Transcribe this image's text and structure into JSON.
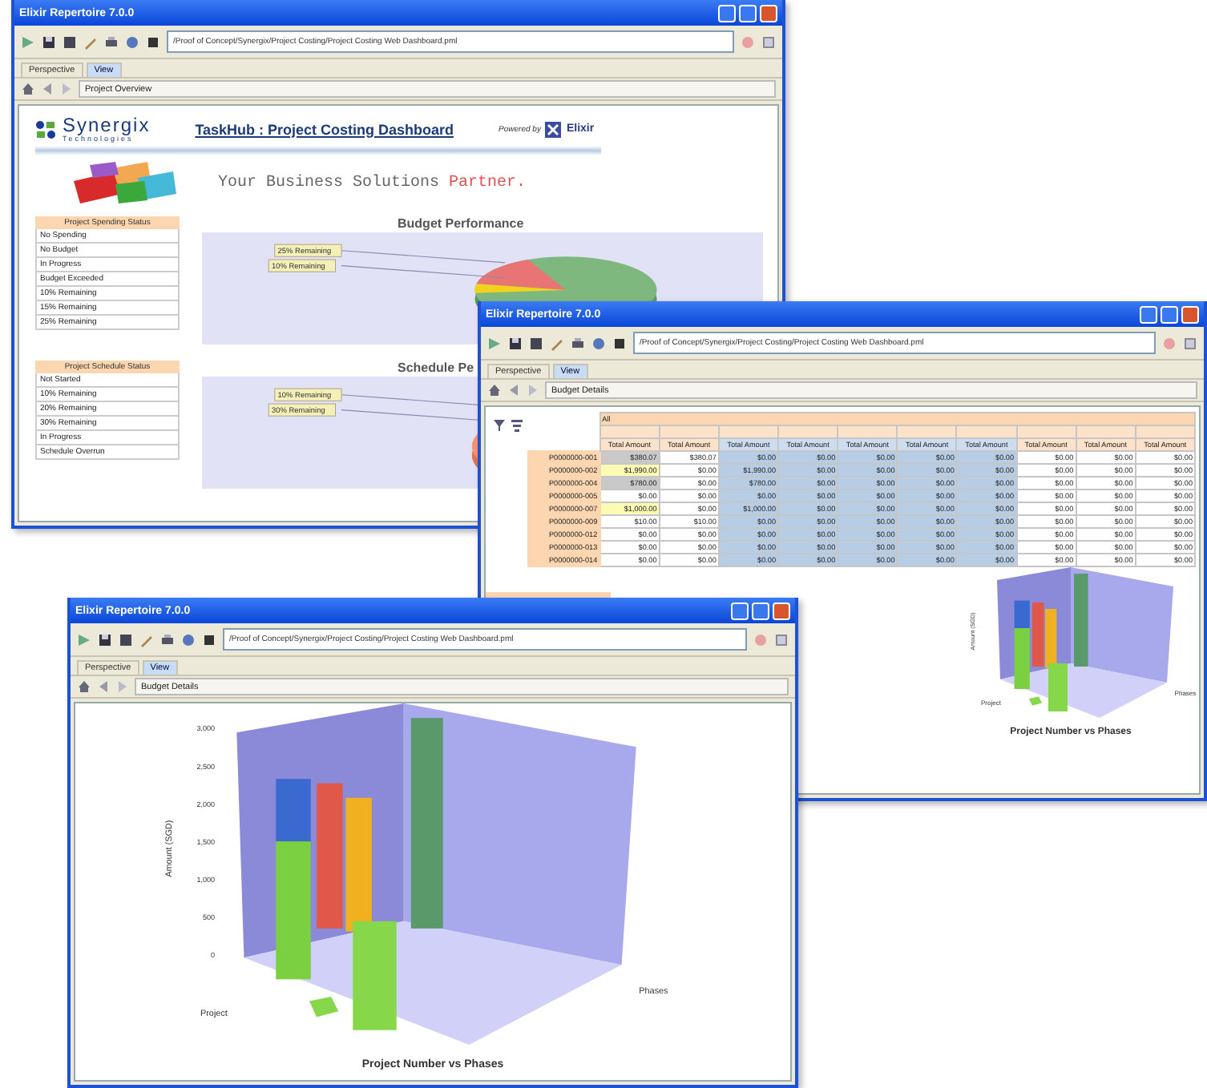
{
  "windows": [
    {
      "kind": "dashboard",
      "title": "Elixir Repertoire 7.0.0",
      "path": "/Proof of Concept/Synergix/Project Costing/Project Costing Web Dashboard.pml",
      "tabs": [
        {
          "label": "Perspective",
          "selected": false
        },
        {
          "label": "View",
          "selected": true
        }
      ],
      "location": "Project Overview",
      "header": {
        "brand": "Synergix",
        "brand_sub": "Technologies",
        "title": "TaskHub : Project Costing Dashboard",
        "powered_by": "Powered by",
        "partner": "Elixir",
        "slogan": "Your Business Solutions ",
        "slogan_accent": "Partner."
      },
      "panels": [
        {
          "kind": "budget",
          "status_title": "Project Spending Status",
          "status_items": [
            "No Spending",
            "No Budget",
            "In Progress",
            "Budget Exceeded",
            "10% Remaining",
            "15% Remaining",
            "25% Remaining"
          ],
          "chart_title": "Budget Performance",
          "callouts": [
            "25% Remaining",
            "10% Remaining"
          ]
        },
        {
          "kind": "schedule",
          "status_title": "Project Schedule Status",
          "status_items": [
            "Not Started",
            "10% Remaining",
            "20% Remaining",
            "30% Remaining",
            "In Progress",
            "Schedule Overrun"
          ],
          "chart_title": "Schedule Pe",
          "callouts": [
            "10% Remaining",
            "30% Remaining"
          ]
        }
      ]
    },
    {
      "kind": "table",
      "title": "Elixir Repertoire 7.0.0",
      "path": "/Proof of Concept/Synergix/Project Costing/Project Costing Web Dashboard.pml",
      "tabs": [
        {
          "label": "Perspective",
          "selected": false
        },
        {
          "label": "View",
          "selected": true
        }
      ],
      "location": "Budget Details",
      "table": {
        "group": "All",
        "columns": [
          {
            "heading": "Total Amount",
            "highlighted": false
          },
          {
            "heading": "Total Amount",
            "highlighted": false
          },
          {
            "heading": "Total Amount",
            "highlighted": true
          },
          {
            "heading": "Total Amount",
            "highlighted": true
          },
          {
            "heading": "Total Amount",
            "highlighted": true
          },
          {
            "heading": "Total Amount",
            "highlighted": true
          },
          {
            "heading": "Total Amount",
            "highlighted": true
          },
          {
            "heading": "Total Amount",
            "highlighted": false
          },
          {
            "heading": "Total Amount",
            "highlighted": false
          },
          {
            "heading": "Total Amount",
            "highlighted": false
          }
        ],
        "rows": [
          {
            "label": "P0000000-001",
            "color": "#c9c9c9",
            "cells": [
              "$380.07",
              "$380.07",
              "$0.00",
              "$0.00",
              "$0.00",
              "$0.00",
              "$0.00",
              "$0.00",
              "$0.00",
              "$0.00"
            ]
          },
          {
            "label": "P0000000-002",
            "color": "#fbfbb4",
            "cells": [
              "$1,990.00",
              "$0.00",
              "$1,990.00",
              "$0.00",
              "$0.00",
              "$0.00",
              "$0.00",
              "$0.00",
              "$0.00",
              "$0.00"
            ]
          },
          {
            "label": "P0000000-004",
            "color": "#c9c9c9",
            "cells": [
              "$780.00",
              "$0.00",
              "$780.00",
              "$0.00",
              "$0.00",
              "$0.00",
              "$0.00",
              "$0.00",
              "$0.00",
              "$0.00"
            ]
          },
          {
            "label": "P0000000-005",
            "cells": [
              "$0.00",
              "$0.00",
              "$0.00",
              "$0.00",
              "$0.00",
              "$0.00",
              "$0.00",
              "$0.00",
              "$0.00",
              "$0.00"
            ]
          },
          {
            "label": "P0000000-007",
            "color": "#fbfbb4",
            "cells": [
              "$1,000.00",
              "$0.00",
              "$1,000.00",
              "$0.00",
              "$0.00",
              "$0.00",
              "$0.00",
              "$0.00",
              "$0.00",
              "$0.00"
            ]
          },
          {
            "label": "P0000000-009",
            "cells": [
              "$10.00",
              "$10.00",
              "$0.00",
              "$0.00",
              "$0.00",
              "$0.00",
              "$0.00",
              "$0.00",
              "$0.00",
              "$0.00"
            ]
          },
          {
            "label": "P0000000-012",
            "cells": [
              "$0.00",
              "$0.00",
              "$0.00",
              "$0.00",
              "$0.00",
              "$0.00",
              "$0.00",
              "$0.00",
              "$0.00",
              "$0.00"
            ]
          },
          {
            "label": "P0000000-013",
            "cells": [
              "$0.00",
              "$0.00",
              "$0.00",
              "$0.00",
              "$0.00",
              "$0.00",
              "$0.00",
              "$0.00",
              "$0.00",
              "$0.00"
            ]
          },
          {
            "label": "P0000000-014",
            "cells": [
              "$0.00",
              "$0.00",
              "$0.00",
              "$0.00",
              "$0.00",
              "$0.00",
              "$0.00",
              "$0.00",
              "$0.00",
              "$0.00"
            ]
          }
        ]
      },
      "chart": {
        "title": "Project Number vs Phases",
        "ylabel": "Amount (SGD)",
        "xlabel": "Project",
        "zlabel": "Phases"
      }
    },
    {
      "kind": "chart",
      "title": "Elixir Repertoire 7.0.0",
      "path": "/Proof of Concept/Synergix/Project Costing/Project Costing Web Dashboard.pml",
      "tabs": [
        {
          "label": "Perspective",
          "selected": false
        },
        {
          "label": "View",
          "selected": true
        }
      ],
      "location": "Budget Details",
      "chart": {
        "title": "Project Number vs Phases",
        "ylabel": "Amount (SGD)",
        "xlabel": "Project",
        "zlabel": "Phases",
        "yticks": [
          "3,000",
          "2,500",
          "2,000",
          "1,500",
          "1,000",
          "500",
          "0"
        ]
      }
    }
  ]
}
